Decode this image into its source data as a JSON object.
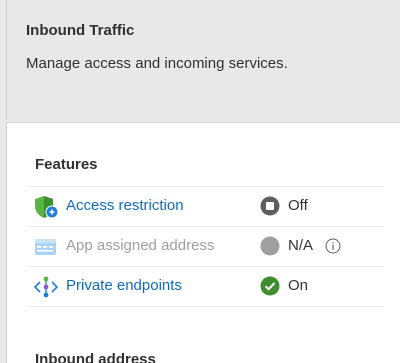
{
  "header": {
    "title": "Inbound Traffic",
    "description": "Manage access and incoming services."
  },
  "features": {
    "title": "Features",
    "rows": [
      {
        "label": "Access restriction",
        "status": "Off",
        "icon": "shield-icon",
        "status_icon": "stop-circle-icon"
      },
      {
        "label": "App assigned address",
        "status": "N/A",
        "icon": "address-card-icon",
        "status_icon": "gray-circle-icon",
        "disabled": true
      },
      {
        "label": "Private endpoints",
        "status": "On",
        "icon": "private-endpoint-icon",
        "status_icon": "check-circle-icon"
      }
    ]
  },
  "next_section": {
    "title": "Inbound address"
  },
  "colors": {
    "link": "#0f6cbd",
    "disabled_text": "#a19f9d",
    "success": "#3e8e2f",
    "off": "#605e5c"
  }
}
